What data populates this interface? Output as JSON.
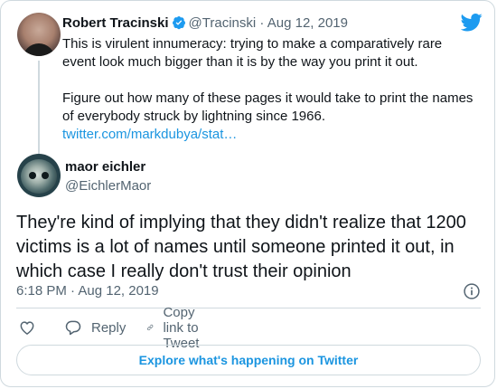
{
  "colors": {
    "twitter_blue": "#1d9bf0",
    "link_blue": "#1b95e0",
    "text": "#0f1419",
    "muted": "#536471",
    "border": "#cfd9de"
  },
  "parent_tweet": {
    "author_name": "Robert Tracinski",
    "verified": true,
    "handle": "@Tracinski",
    "separator": "·",
    "date": "Aug 12, 2019",
    "text_line_1": "This is virulent innumeracy: trying to make a comparatively rare event look much bigger than it is by the way you print it out.",
    "text_line_2": "Figure out how many of these pages it would take to print the names of everybody struck by lightning since 1966.",
    "link_text": "twitter.com/markdubya/stat…"
  },
  "main_tweet": {
    "author_name": "maor eichler",
    "handle": "@EichlerMaor",
    "text": "They're kind of implying that they didn't realize that 1200 victims is a lot of names until someone printed it out, in which case I really don't trust their opinion",
    "timestamp": "6:18 PM · Aug 12, 2019"
  },
  "actions": {
    "like_icon": "heart-icon",
    "reply_label": "Reply",
    "copy_link_label": "Copy link to Tweet"
  },
  "footer": {
    "explore_label": "Explore what's happening on Twitter"
  },
  "icons": [
    "twitter-bird-icon",
    "verified-badge-icon",
    "info-icon",
    "heart-icon",
    "reply-icon",
    "link-icon"
  ]
}
